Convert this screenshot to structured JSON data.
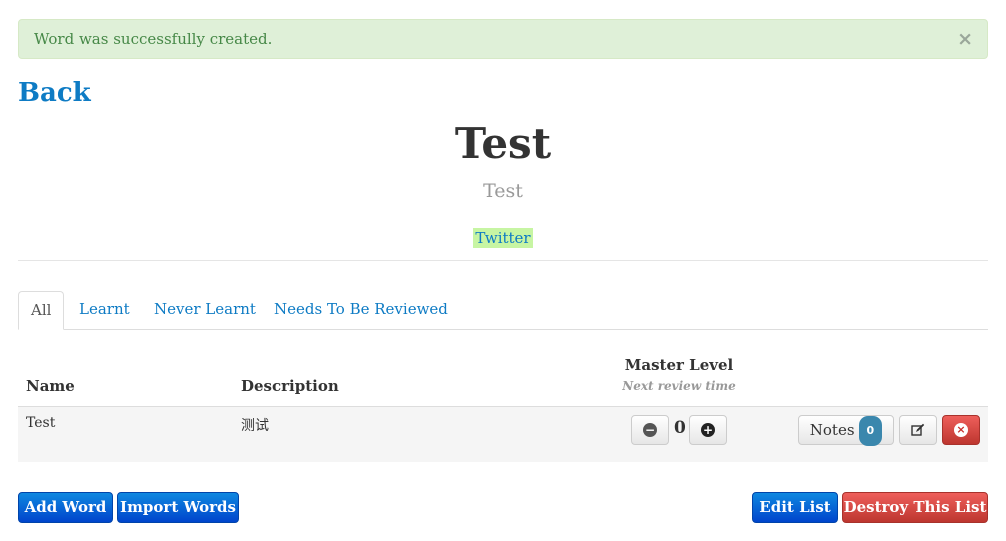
{
  "alert": {
    "message": "Word was successfully created.",
    "close": "×"
  },
  "nav": {
    "back": "Back"
  },
  "header": {
    "title": "Test",
    "subtitle": "Test",
    "twitter": "Twitter"
  },
  "tabs": [
    {
      "label": "All",
      "active": true
    },
    {
      "label": "Learnt"
    },
    {
      "label": "Never Learnt"
    },
    {
      "label": "Needs To Be Reviewed"
    }
  ],
  "table": {
    "headers": {
      "name": "Name",
      "description": "Description",
      "master_level": "Master Level",
      "next_review": "Next review time"
    },
    "rows": [
      {
        "name": "Test",
        "description": "测试",
        "level": "0",
        "notes_label": "Notes",
        "notes_count": "0"
      }
    ]
  },
  "actions": {
    "add_word": "Add Word",
    "import_words": "Import Words",
    "edit_list": "Edit List",
    "destroy_list": "Destroy This List"
  },
  "colors": {
    "link": "#0e7bc4",
    "primary": "#0055cc",
    "danger": "#da4f49",
    "success_bg": "#dff0d8"
  }
}
